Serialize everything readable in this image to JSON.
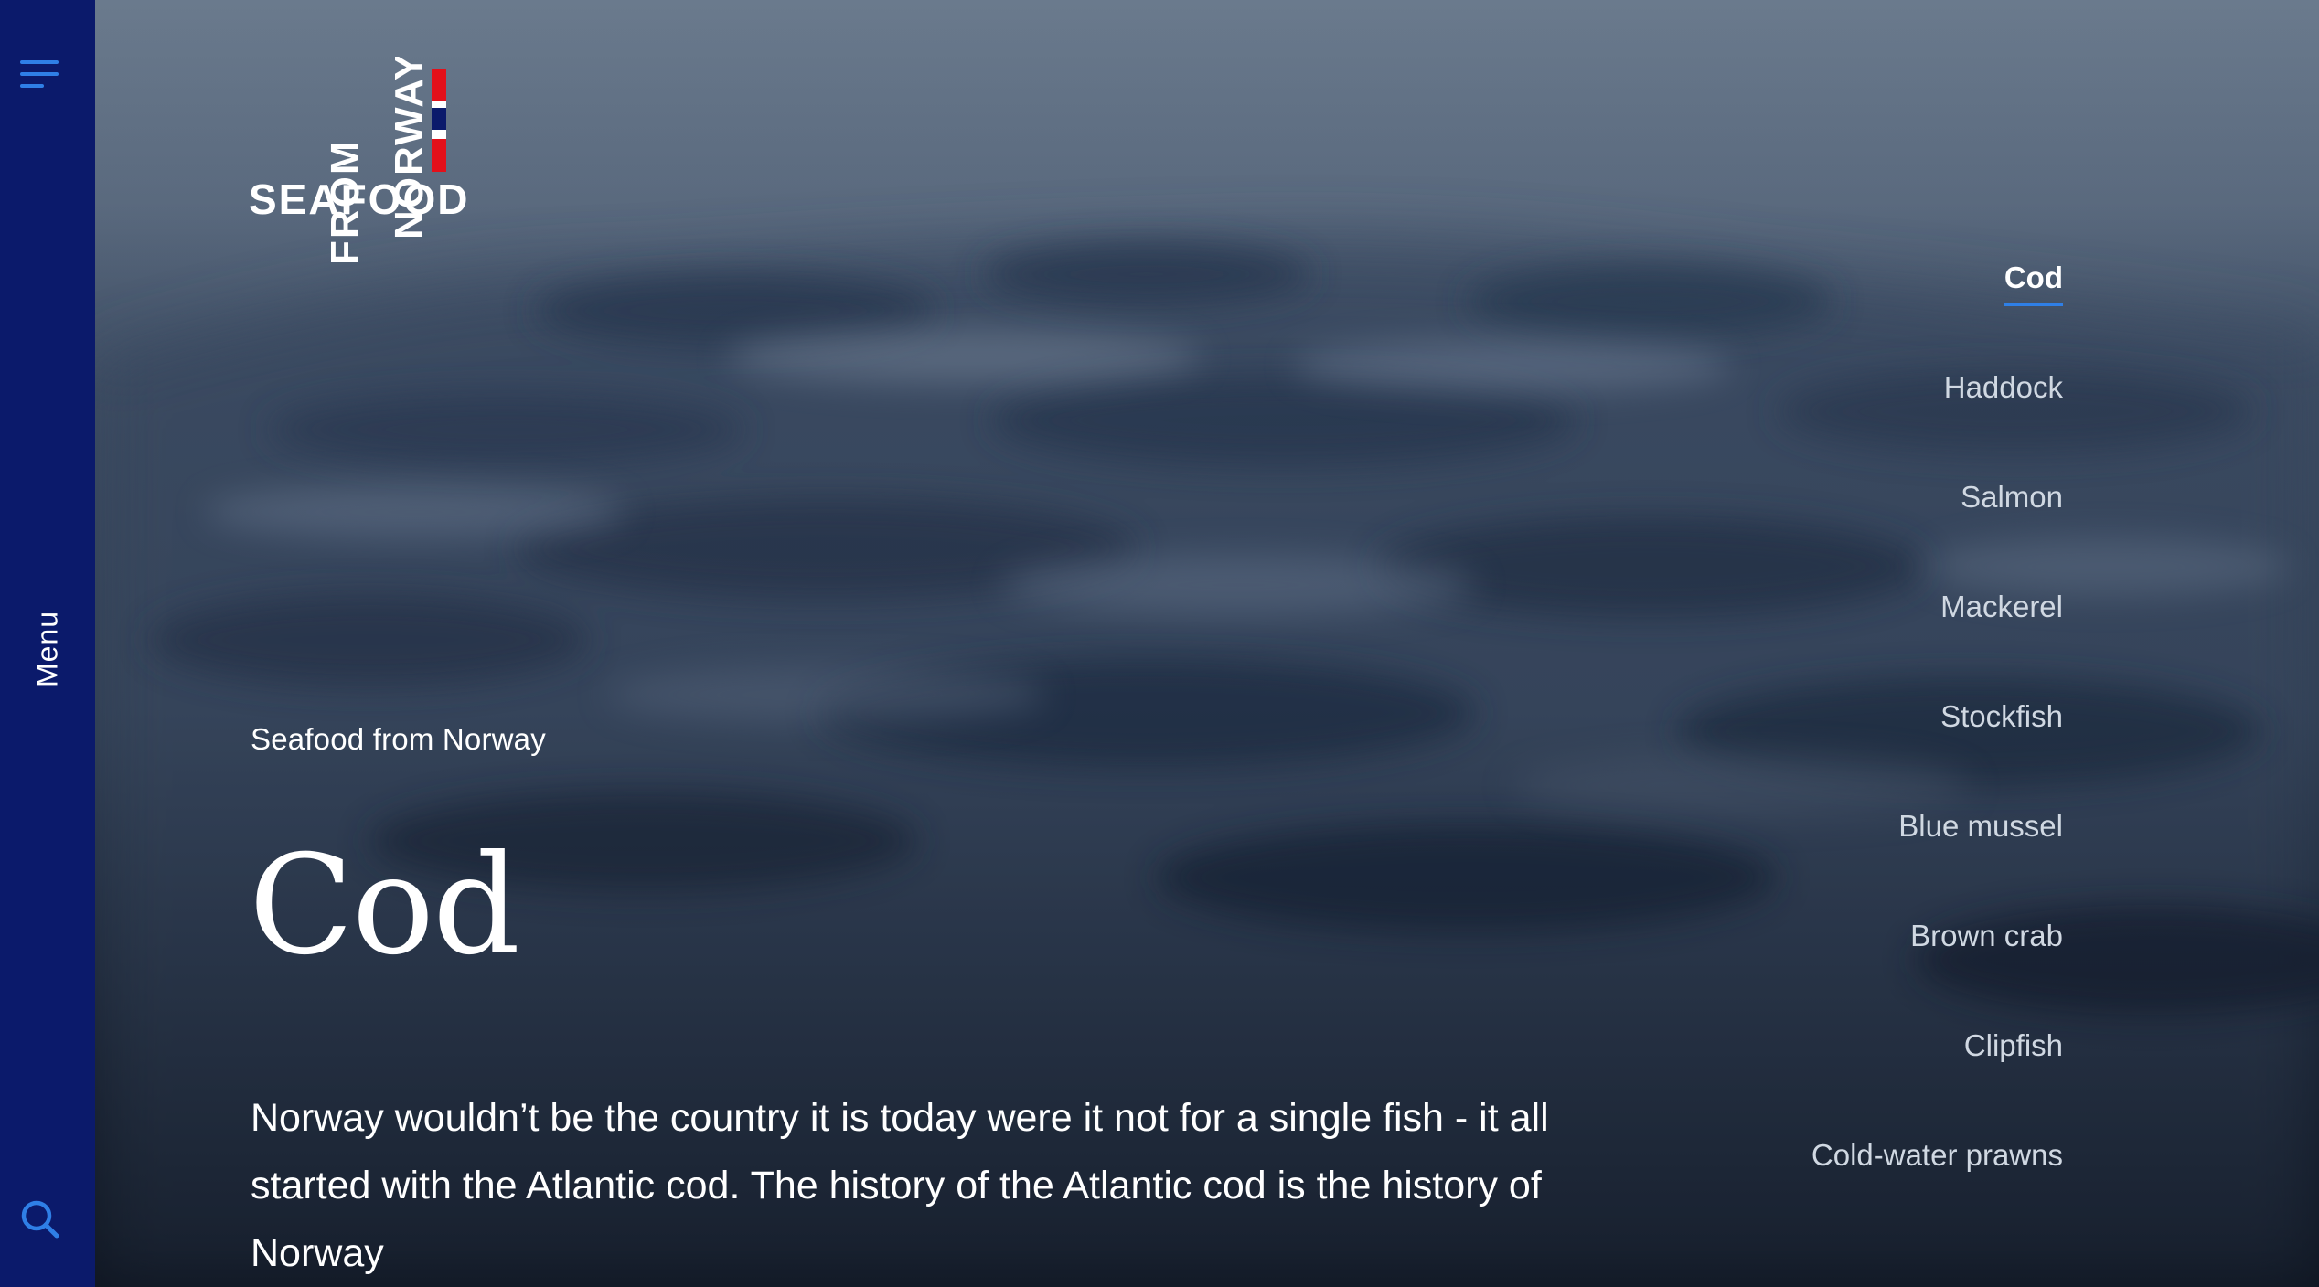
{
  "sidebar": {
    "menu_label": "Menu",
    "icons": [
      "hamburger-icon",
      "search-icon"
    ],
    "accent_color": "#2f7fe6",
    "background_color": "#0b1a6b"
  },
  "logo": {
    "text_line1": "SEAFOOD",
    "text_line2": "FROM",
    "text_line3": "NORWAY"
  },
  "hero": {
    "eyebrow": "Seafood from Norway",
    "title": "Cod",
    "intro": "Norway wouldn’t be the country it is today were it not for a single fish - it all started with the Atlantic cod. The history of the Atlantic cod is the history of Norway"
  },
  "species_nav": {
    "active": "Cod",
    "items": [
      {
        "label": "Cod"
      },
      {
        "label": "Haddock"
      },
      {
        "label": "Salmon"
      },
      {
        "label": "Mackerel"
      },
      {
        "label": "Stockfish"
      },
      {
        "label": "Blue mussel"
      },
      {
        "label": "Brown crab"
      },
      {
        "label": "Clipfish"
      },
      {
        "label": "Cold-water prawns"
      }
    ]
  }
}
